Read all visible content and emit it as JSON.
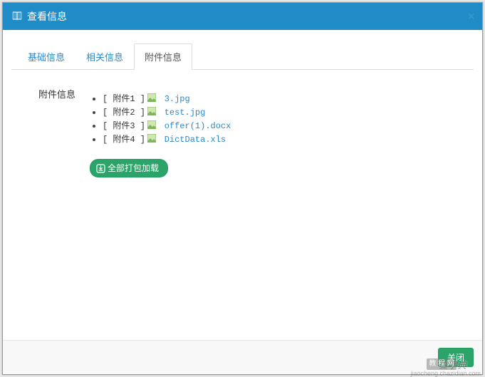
{
  "dialog": {
    "title": "查看信息",
    "close_label": "×"
  },
  "tabs": [
    {
      "label": "基础信息",
      "active": false
    },
    {
      "label": "相关信息",
      "active": false
    },
    {
      "label": "附件信息",
      "active": true
    }
  ],
  "section": {
    "heading": "附件信息"
  },
  "attachments": [
    {
      "label": "[ 附件1 ]",
      "filename": "3.jpg"
    },
    {
      "label": "[ 附件2 ]",
      "filename": "test.jpg"
    },
    {
      "label": "[ 附件3 ]",
      "filename": "offer(1).docx"
    },
    {
      "label": "[ 附件4 ]",
      "filename": "DictData.xls"
    }
  ],
  "buttons": {
    "download_all": "全部打包加载",
    "close": "关闭"
  },
  "watermark": {
    "text": "查字典",
    "badge": "教 程 网",
    "url": "jiaocheng.chazidian.com"
  }
}
